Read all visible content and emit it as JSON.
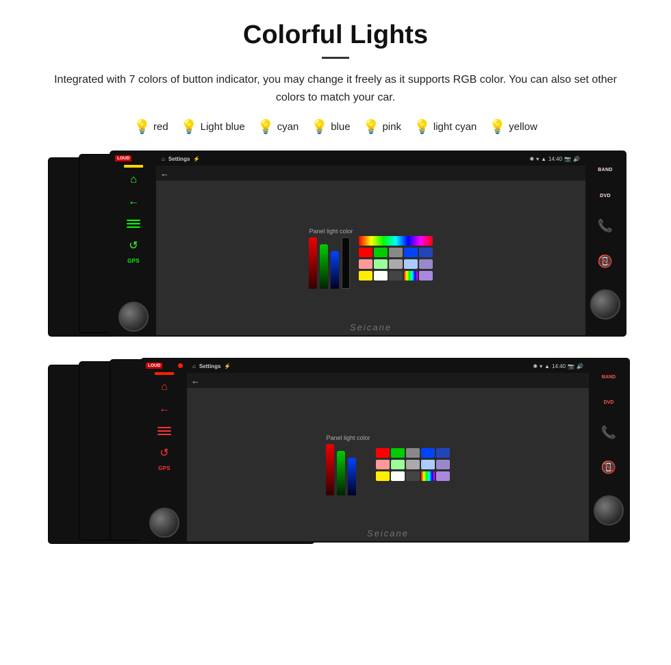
{
  "header": {
    "title": "Colorful Lights",
    "description": "Integrated with 7 colors of button indicator, you may change it freely as it supports RGB color. You can also set other colors to match your car."
  },
  "colors": [
    {
      "name": "red",
      "emoji": "🔴",
      "hex": "#ff0000"
    },
    {
      "name": "Light blue",
      "emoji": "💙",
      "hex": "#66bbff"
    },
    {
      "name": "cyan",
      "emoji": "💠",
      "hex": "#00ffff"
    },
    {
      "name": "blue",
      "emoji": "🔵",
      "hex": "#0044ff"
    },
    {
      "name": "pink",
      "emoji": "💗",
      "hex": "#ff44aa"
    },
    {
      "name": "light cyan",
      "emoji": "🩵",
      "hex": "#aaeeff"
    },
    {
      "name": "yellow",
      "emoji": "💛",
      "hex": "#ffff00"
    }
  ],
  "panel": {
    "setting_title": "Settings",
    "time": "14:40",
    "panel_light_label": "Panel light color",
    "watermark": "Seicane",
    "band_label": "BAND",
    "dvd_label": "DVD",
    "gps_label": "GPS",
    "loud_label": "LOUD"
  },
  "icons": {
    "home": "⌂",
    "back": "←",
    "menu": "≡",
    "refresh": "↺",
    "phone_green": "📞",
    "phone_red": "📵"
  }
}
